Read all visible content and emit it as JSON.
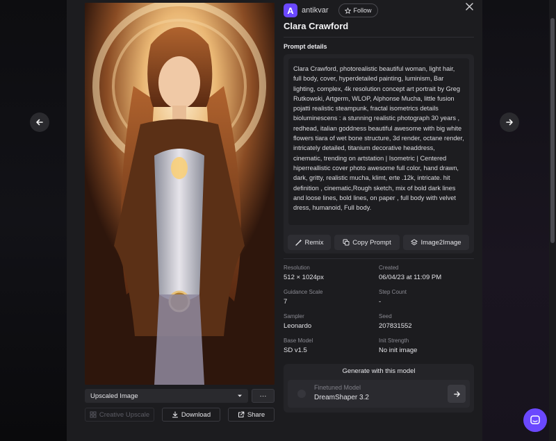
{
  "navigation": {
    "prev_icon": "arrow-left-icon",
    "next_icon": "arrow-right-icon",
    "close_icon": "close-icon"
  },
  "author": {
    "avatar_letter": "A",
    "name": "antikvar",
    "follow_label": "Follow"
  },
  "title": "Clara Crawford",
  "prompt": {
    "section_label": "Prompt details",
    "text": "Clara Crawford, photorealistic beautiful woman, light hair, full body, cover, hyperdetailed painting, luminism, Bar lighting, complex, 4k resolution concept art portrait by Greg Rutkowski, Artgerm, WLOP, Alphonse Mucha, little fusion pojatti realistic steampunk, fractal isometrics details bioluminescens : a stunning realistic photograph 30 years , redhead, italian goddness beautiful awesome with big white flowers tiara of wet bone structure, 3d render, octane render, intricately detailed, titanium decorative headdress, cinematic, trending on artstation | Isometric | Centered hiperreallistic cover photo awesome full color, hand drawn, dark, gritty, realistic mucha, klimt, erte .12k, intricate. hit definition , cinematic,Rough sketch, mix of bold dark lines and loose lines, bold lines, on paper , full body with velvet dress, humanoid, Full body.",
    "actions": [
      {
        "label": "Remix",
        "icon": "magic-wand-icon"
      },
      {
        "label": "Copy Prompt",
        "icon": "copy-icon"
      },
      {
        "label": "Image2Image",
        "icon": "layers-icon"
      }
    ]
  },
  "details": [
    {
      "label": "Resolution",
      "value": "512 × 1024px"
    },
    {
      "label": "Created",
      "value": "06/04/23 at 11:09 PM"
    },
    {
      "label": "Guidance Scale",
      "value": "7"
    },
    {
      "label": "Step Count",
      "value": "-"
    },
    {
      "label": "Sampler",
      "value": "Leonardo"
    },
    {
      "label": "Seed",
      "value": "207831552"
    },
    {
      "label": "Base Model",
      "value": "SD v1.5"
    },
    {
      "label": "Init Strength",
      "value": "No init image"
    }
  ],
  "generate": {
    "title": "Generate with this model",
    "model_label": "Finetuned Model",
    "model_name": "DreamShaper 3.2"
  },
  "image_controls": {
    "select_value": "Upscaled Image",
    "more_label": "···",
    "creative_upscale_label": "Creative Upscale",
    "download_label": "Download",
    "share_label": "Share"
  },
  "colors": {
    "accent": "#6b48ff",
    "panel": "#1c1c1f",
    "card": "#242428"
  }
}
